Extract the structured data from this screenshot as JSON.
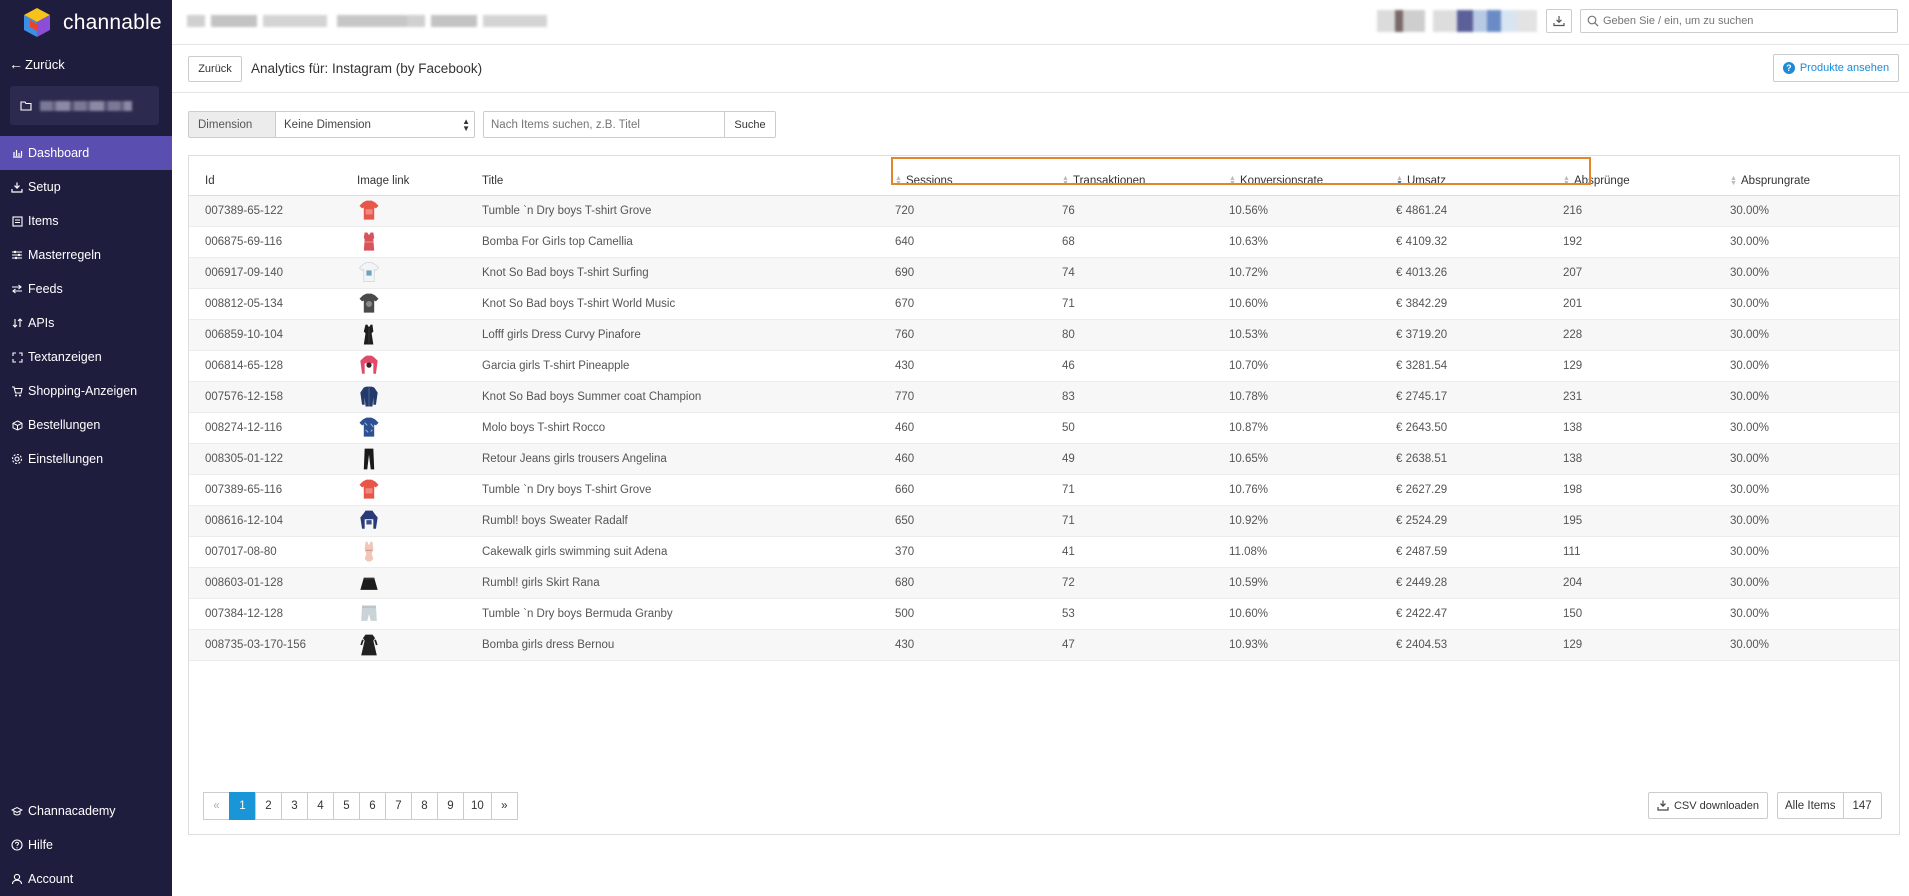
{
  "app": {
    "name": "channable"
  },
  "colors": {
    "sidebar_bg": "#1f1d3e",
    "sidebar_active": "#5a4fb0",
    "accent": "#1a95d8",
    "highlight_border": "#e3852a"
  },
  "sidebar": {
    "back_label": "Zurück",
    "items": [
      {
        "label": "Dashboard",
        "icon": "bar-chart-icon",
        "active": true
      },
      {
        "label": "Setup",
        "icon": "download-icon"
      },
      {
        "label": "Items",
        "icon": "list-icon"
      },
      {
        "label": "Masterregeln",
        "icon": "sliders-icon"
      },
      {
        "label": "Feeds",
        "icon": "arrows-icon"
      },
      {
        "label": "APIs",
        "icon": "sort-icon"
      },
      {
        "label": "Textanzeigen",
        "icon": "expand-icon"
      },
      {
        "label": "Shopping-Anzeigen",
        "icon": "cart-icon"
      },
      {
        "label": "Bestellungen",
        "icon": "box-icon"
      },
      {
        "label": "Einstellungen",
        "icon": "gear-icon"
      }
    ],
    "bottom_items": [
      {
        "label": "Channacademy",
        "icon": "graduation-cap-icon"
      },
      {
        "label": "Hilfe",
        "icon": "question-circle-icon"
      },
      {
        "label": "Account",
        "icon": "user-icon"
      }
    ]
  },
  "topbar": {
    "search_placeholder": "Geben Sie / ein, um zu suchen"
  },
  "header": {
    "back_button": "Zurück",
    "title": "Analytics für: Instagram (by Facebook)",
    "products_button": "Produkte ansehen"
  },
  "filters": {
    "dimension_label": "Dimension",
    "dimension_value": "Keine Dimension",
    "search_placeholder": "Nach Items suchen, z.B. Titel",
    "search_button": "Suche"
  },
  "table": {
    "columns": [
      "Id",
      "Image link",
      "Title",
      "Sessions",
      "Transaktionen",
      "Konversionsrate",
      "Umsatz",
      "Absprünge",
      "Absprungrate"
    ],
    "rows": [
      {
        "id": "007389-65-122",
        "img": "red-tshirt",
        "title": "Tumble `n Dry boys T-shirt Grove",
        "sessions": "720",
        "trans": "76",
        "rate": "10.56%",
        "revenue": "€ 4861.24",
        "bounces": "216",
        "bounce_rate": "30.00%"
      },
      {
        "id": "006875-69-116",
        "img": "red-top",
        "title": "Bomba For Girls top Camellia",
        "sessions": "640",
        "trans": "68",
        "rate": "10.63%",
        "revenue": "€ 4109.32",
        "bounces": "192",
        "bounce_rate": "30.00%"
      },
      {
        "id": "006917-09-140",
        "img": "white-tshirt",
        "title": "Knot So Bad boys T-shirt Surfing",
        "sessions": "690",
        "trans": "74",
        "rate": "10.72%",
        "revenue": "€ 4013.26",
        "bounces": "207",
        "bounce_rate": "30.00%"
      },
      {
        "id": "008812-05-134",
        "img": "grey-tshirt",
        "title": "Knot So Bad boys T-shirt World Music",
        "sessions": "670",
        "trans": "71",
        "rate": "10.60%",
        "revenue": "€ 3842.29",
        "bounces": "201",
        "bounce_rate": "30.00%"
      },
      {
        "id": "006859-10-104",
        "img": "black-dress",
        "title": "Lofff girls Dress Curvy Pinafore",
        "sessions": "760",
        "trans": "80",
        "rate": "10.53%",
        "revenue": "€ 3719.20",
        "bounces": "228",
        "bounce_rate": "30.00%"
      },
      {
        "id": "006814-65-128",
        "img": "pink-sweater",
        "title": "Garcia girls T-shirt Pineapple",
        "sessions": "430",
        "trans": "46",
        "rate": "10.70%",
        "revenue": "€ 3281.54",
        "bounces": "129",
        "bounce_rate": "30.00%"
      },
      {
        "id": "007576-12-158",
        "img": "navy-coat",
        "title": "Knot So Bad boys Summer coat Champion",
        "sessions": "770",
        "trans": "83",
        "rate": "10.78%",
        "revenue": "€ 2745.17",
        "bounces": "231",
        "bounce_rate": "30.00%"
      },
      {
        "id": "008274-12-116",
        "img": "blue-tshirt",
        "title": "Molo boys T-shirt Rocco",
        "sessions": "460",
        "trans": "50",
        "rate": "10.87%",
        "revenue": "€ 2643.50",
        "bounces": "138",
        "bounce_rate": "30.00%"
      },
      {
        "id": "008305-01-122",
        "img": "black-trousers",
        "title": "Retour Jeans girls trousers Angelina",
        "sessions": "460",
        "trans": "49",
        "rate": "10.65%",
        "revenue": "€ 2638.51",
        "bounces": "138",
        "bounce_rate": "30.00%"
      },
      {
        "id": "007389-65-116",
        "img": "red-tshirt",
        "title": "Tumble `n Dry boys T-shirt Grove",
        "sessions": "660",
        "trans": "71",
        "rate": "10.76%",
        "revenue": "€ 2627.29",
        "bounces": "198",
        "bounce_rate": "30.00%"
      },
      {
        "id": "008616-12-104",
        "img": "navy-hoodie",
        "title": "Rumbl! boys Sweater Radalf",
        "sessions": "650",
        "trans": "71",
        "rate": "10.92%",
        "revenue": "€ 2524.29",
        "bounces": "195",
        "bounce_rate": "30.00%"
      },
      {
        "id": "007017-08-80",
        "img": "swimsuit",
        "title": "Cakewalk girls swimming suit Adena",
        "sessions": "370",
        "trans": "41",
        "rate": "11.08%",
        "revenue": "€ 2487.59",
        "bounces": "111",
        "bounce_rate": "30.00%"
      },
      {
        "id": "008603-01-128",
        "img": "black-skirt",
        "title": "Rumbl! girls Skirt Rana",
        "sessions": "680",
        "trans": "72",
        "rate": "10.59%",
        "revenue": "€ 2449.28",
        "bounces": "204",
        "bounce_rate": "30.00%"
      },
      {
        "id": "007384-12-128",
        "img": "grey-shorts",
        "title": "Tumble `n Dry boys Bermuda Granby",
        "sessions": "500",
        "trans": "53",
        "rate": "10.60%",
        "revenue": "€ 2422.47",
        "bounces": "150",
        "bounce_rate": "30.00%"
      },
      {
        "id": "008735-03-170-156",
        "img": "black-longdress",
        "title": "Bomba girls dress Bernou",
        "sessions": "430",
        "trans": "47",
        "rate": "10.93%",
        "revenue": "€ 2404.53",
        "bounces": "129",
        "bounce_rate": "30.00%"
      }
    ]
  },
  "pagination": {
    "prev": "«",
    "next": "»",
    "pages": [
      "1",
      "2",
      "3",
      "4",
      "5",
      "6",
      "7",
      "8",
      "9",
      "10"
    ],
    "current": "1"
  },
  "footer": {
    "csv_button": "CSV downloaden",
    "all_items_label": "Alle Items",
    "all_items_count": "147"
  }
}
